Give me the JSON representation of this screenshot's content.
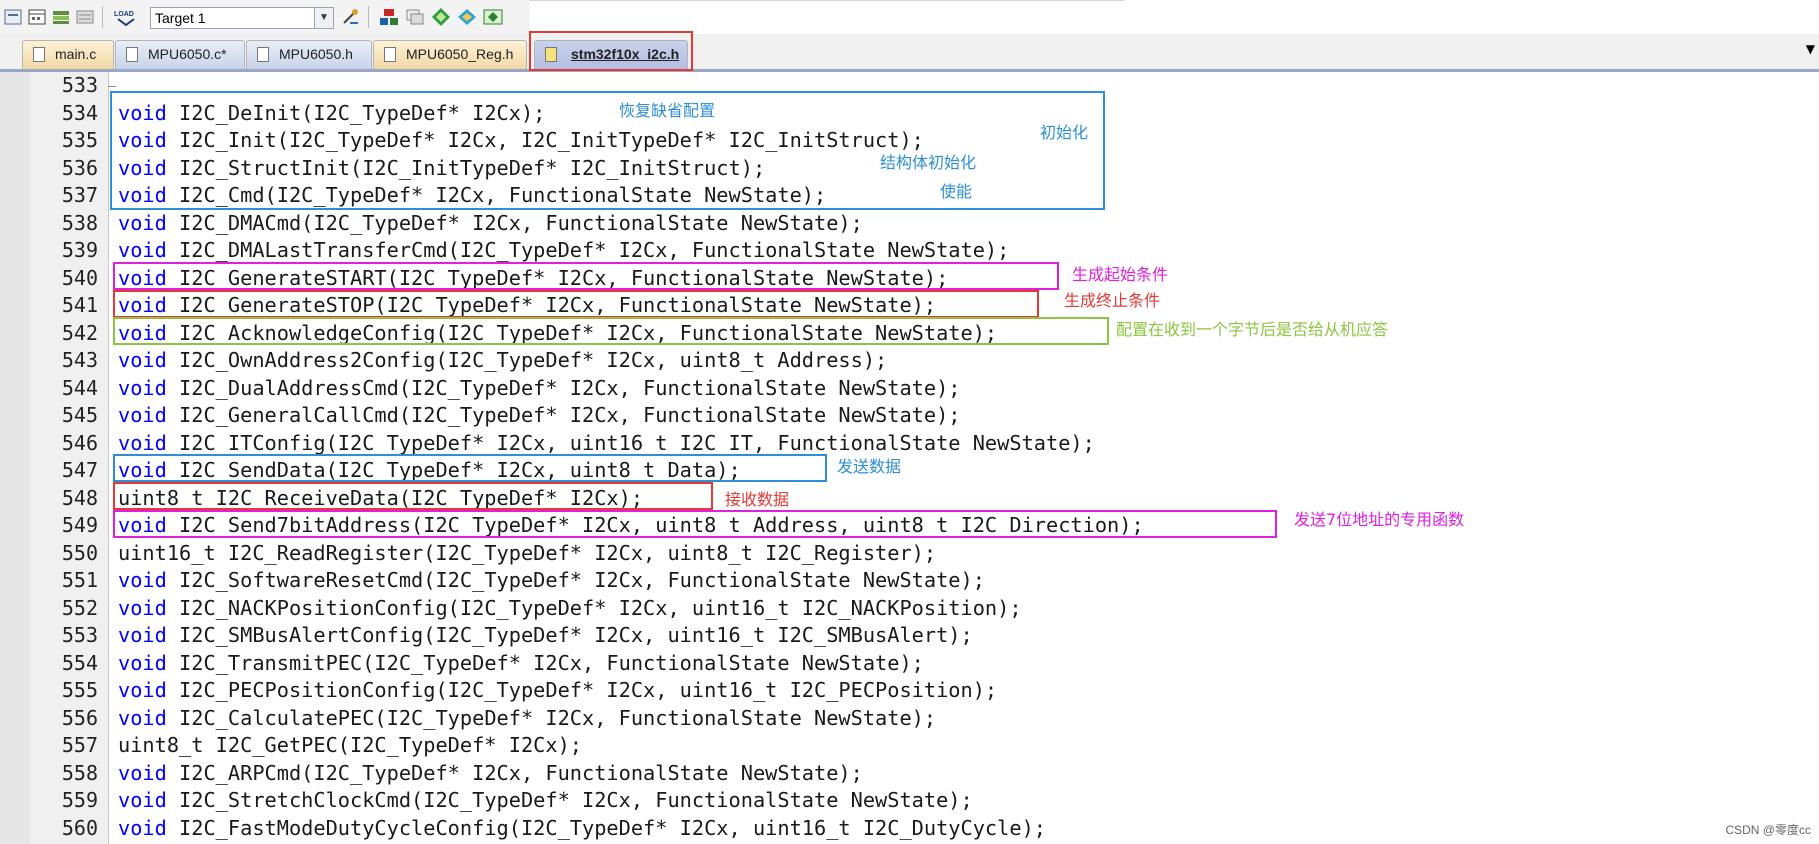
{
  "toolbar": {
    "target_value": "Target 1",
    "load_label": "LOAD"
  },
  "tabs": [
    {
      "label": "main.c",
      "type": "c"
    },
    {
      "label": "MPU6050.c*",
      "type": "h"
    },
    {
      "label": "MPU6050.h",
      "type": "h"
    },
    {
      "label": "MPU6050_Reg.h",
      "type": "c"
    },
    {
      "label": "stm32f10x_i2c.h",
      "type": "h",
      "active": true
    }
  ],
  "editor": {
    "lines": [
      {
        "num": "533",
        "kw": "",
        "rest": ""
      },
      {
        "num": "534",
        "kw": "void",
        "rest": " I2C_DeInit(I2C_TypeDef* I2Cx);"
      },
      {
        "num": "535",
        "kw": "void",
        "rest": " I2C_Init(I2C_TypeDef* I2Cx, I2C_InitTypeDef* I2C_InitStruct);"
      },
      {
        "num": "536",
        "kw": "void",
        "rest": " I2C_StructInit(I2C_InitTypeDef* I2C_InitStruct);"
      },
      {
        "num": "537",
        "kw": "void",
        "rest": " I2C_Cmd(I2C_TypeDef* I2Cx, FunctionalState NewState);"
      },
      {
        "num": "538",
        "kw": "void",
        "rest": " I2C_DMACmd(I2C_TypeDef* I2Cx, FunctionalState NewState);"
      },
      {
        "num": "539",
        "kw": "void",
        "rest": " I2C_DMALastTransferCmd(I2C_TypeDef* I2Cx, FunctionalState NewState);"
      },
      {
        "num": "540",
        "kw": "void",
        "rest": " I2C_GenerateSTART(I2C_TypeDef* I2Cx, FunctionalState NewState);"
      },
      {
        "num": "541",
        "kw": "void",
        "rest": " I2C_GenerateSTOP(I2C_TypeDef* I2Cx, FunctionalState NewState);"
      },
      {
        "num": "542",
        "kw": "void",
        "rest": " I2C_AcknowledgeConfig(I2C_TypeDef* I2Cx, FunctionalState NewState);"
      },
      {
        "num": "543",
        "kw": "void",
        "rest": " I2C_OwnAddress2Config(I2C_TypeDef* I2Cx, uint8_t Address);"
      },
      {
        "num": "544",
        "kw": "void",
        "rest": " I2C_DualAddressCmd(I2C_TypeDef* I2Cx, FunctionalState NewState);"
      },
      {
        "num": "545",
        "kw": "void",
        "rest": " I2C_GeneralCallCmd(I2C_TypeDef* I2Cx, FunctionalState NewState);"
      },
      {
        "num": "546",
        "kw": "void",
        "rest": " I2C_ITConfig(I2C_TypeDef* I2Cx, uint16_t I2C_IT, FunctionalState NewState);"
      },
      {
        "num": "547",
        "kw": "void",
        "rest": " I2C_SendData(I2C_TypeDef* I2Cx, uint8_t Data);"
      },
      {
        "num": "548",
        "kw": "",
        "rest": "uint8_t I2C_ReceiveData(I2C_TypeDef* I2Cx);"
      },
      {
        "num": "549",
        "kw": "void",
        "rest": " I2C_Send7bitAddress(I2C_TypeDef* I2Cx, uint8_t Address, uint8_t I2C_Direction);"
      },
      {
        "num": "550",
        "kw": "",
        "rest": "uint16_t I2C_ReadRegister(I2C_TypeDef* I2Cx, uint8_t I2C_Register);"
      },
      {
        "num": "551",
        "kw": "void",
        "rest": " I2C_SoftwareResetCmd(I2C_TypeDef* I2Cx, FunctionalState NewState);"
      },
      {
        "num": "552",
        "kw": "void",
        "rest": " I2C_NACKPositionConfig(I2C_TypeDef* I2Cx, uint16_t I2C_NACKPosition);"
      },
      {
        "num": "553",
        "kw": "void",
        "rest": " I2C_SMBusAlertConfig(I2C_TypeDef* I2Cx, uint16_t I2C_SMBusAlert);"
      },
      {
        "num": "554",
        "kw": "void",
        "rest": " I2C_TransmitPEC(I2C_TypeDef* I2Cx, FunctionalState NewState);"
      },
      {
        "num": "555",
        "kw": "void",
        "rest": " I2C_PECPositionConfig(I2C_TypeDef* I2Cx, uint16_t I2C_PECPosition);"
      },
      {
        "num": "556",
        "kw": "void",
        "rest": " I2C_CalculatePEC(I2C_TypeDef* I2Cx, FunctionalState NewState);"
      },
      {
        "num": "557",
        "kw": "",
        "rest": "uint8_t I2C_GetPEC(I2C_TypeDef* I2Cx);"
      },
      {
        "num": "558",
        "kw": "void",
        "rest": " I2C_ARPCmd(I2C_TypeDef* I2Cx, FunctionalState NewState);"
      },
      {
        "num": "559",
        "kw": "void",
        "rest": " I2C_StretchClockCmd(I2C_TypeDef* I2Cx, FunctionalState NewState);"
      },
      {
        "num": "560",
        "kw": "void",
        "rest": " I2C_FastModeDutyCycleConfig(I2C_TypeDef* I2Cx, uint16_t I2C_DutyCycle);"
      }
    ]
  },
  "annotations": {
    "restore_default": "恢复缺省配置",
    "init": "初始化",
    "struct_init": "结构体初始化",
    "enable": "使能",
    "gen_start": "生成起始条件",
    "gen_stop": "生成终止条件",
    "ack_config": "配置在收到一个字节后是否给从机应答",
    "send_data": "发送数据",
    "receive_data": "接收数据",
    "send_7bit": "发送7位地址的专用函数"
  },
  "colors": {
    "keyword": "#0000ff",
    "blue_box": "#2e8fd6",
    "magenta_box": "#e020e0",
    "red_box": "#e53935",
    "green_box": "#8cc63e"
  },
  "watermark": "CSDN @零度cc"
}
